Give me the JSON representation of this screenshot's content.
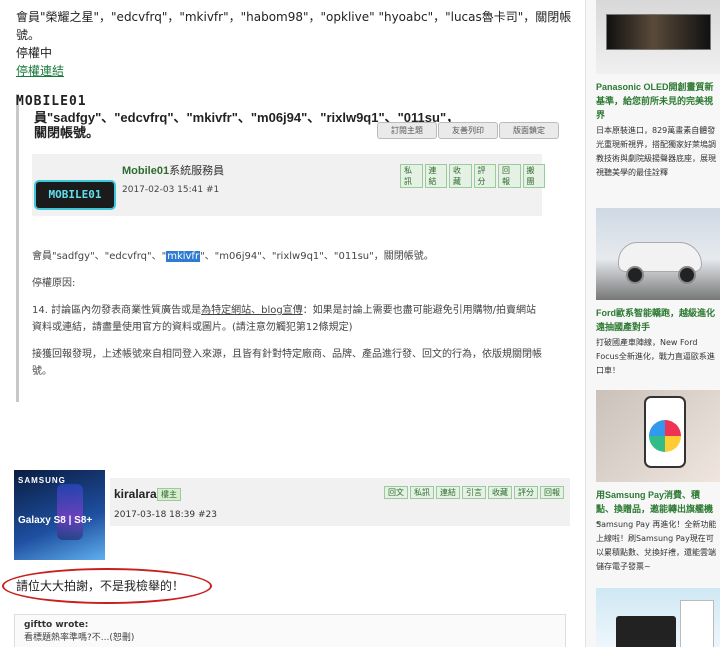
{
  "intro": {
    "line1": "會員\"榮耀之星\"，\"edcvfrq\"，\"mkivfr\"，\"habom98\"，\"opklive\" \"hyoabc\"，\"lucas魯卡司\"，關閉帳號。",
    "status": "停權中",
    "link": "停權連結"
  },
  "screenshot": {
    "logo": "MOBILE01",
    "title": "員\"sadfgy\"、\"edcvfrq\"、\"mkivfr\"、\"m06j94\"、\"rixlw9q1\"、\"011su\"，關閉帳號。",
    "top_buttons": [
      "訂閱主題",
      "友善列印",
      "版面鎖定"
    ],
    "author": "Mobile01",
    "author_suffix": "系統服務員",
    "date": "2017-02-03 15:41  #1",
    "avatar_text": "MOBILE01",
    "actions": [
      "私訊",
      "連結",
      "收藏",
      "評分",
      "回報",
      "搬團"
    ],
    "body_pre": "會員\"sadfgy\"、\"edcvfrq\"、\"",
    "body_hl": "mkivfr",
    "body_post": "\"、\"m06j94\"、\"rixlw9q1\"、\"011su\"，關閉帳號。",
    "reason_label": "停權原因:",
    "rule_pre": "14. 討論區內勿發表商業性質廣告或是",
    "rule_ul": "為特定網站、blog宣傳",
    "rule_post": "：如果是討論上需要也盡可能避免引用購物/拍賣網站資料或連結，請盡量使用官方的資料或圖片。(請注意勿觸犯第12條規定)",
    "report": "接獲回報發現，上述帳號來自相同登入來源，且皆有針對特定廠商、品牌、產品進行發、回文的行為，依版規關閉帳號。"
  },
  "reply": {
    "avatar_brand": "SAMSUNG",
    "avatar_model": "Galaxy S8 | S8+",
    "user": "kiralara",
    "role": "樓主",
    "date": "2017-03-18 18:39  #23",
    "actions": [
      "回文",
      "私訊",
      "連結",
      "引言",
      "收藏",
      "評分",
      "回報"
    ],
    "text": "請位大大拍謝，不是我檢舉的！",
    "quote_author": "giftto wrote:",
    "quote_text": "看標題熱率準嗎?不...(恕刪)"
  },
  "sidebar": {
    "ads": [
      {
        "title": "Panasonic OLED開創畫質新基準，給您前所未見的完美視界",
        "desc": "日本原裝進口，829萬畫素自體發光重現新視界，搭配獨家好萊塢調教技術與劇院級揚聲器底座，展現視聽美學的最佳詮釋"
      },
      {
        "title": "Ford歐系智能轎跑，越級進化遠抽國產對手",
        "desc": "打破國產車陣線，New Ford Focus全新進化，戰力直逼歐系進口車！"
      },
      {
        "title": "用Samsung Pay消費、積點、換贈品，邀能轉出旗艦機~",
        "desc": "Samsung Pay 再進化！全新功能上線啦！刷Samsung Pay現在可以累積點數、兌換好禮，還能雲端儲存電子發票~"
      }
    ]
  }
}
